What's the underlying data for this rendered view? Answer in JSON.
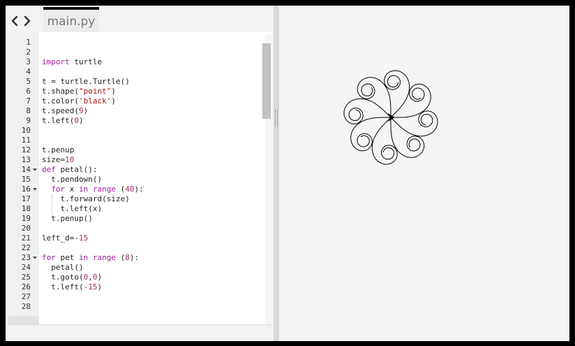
{
  "tab": {
    "label": "main.py"
  },
  "icons": {
    "back": "chevron-left-icon",
    "forward": "chevron-right-icon",
    "fold": "fold-arrow-icon"
  },
  "editor": {
    "lines": [
      {
        "num": "1",
        "text": ""
      },
      {
        "num": "2",
        "text": ""
      },
      {
        "num": "3",
        "text": "import turtle"
      },
      {
        "num": "4",
        "text": ""
      },
      {
        "num": "5",
        "text": "t = turtle.Turtle()"
      },
      {
        "num": "6",
        "text": "t.shape(\"point\")"
      },
      {
        "num": "7",
        "text": "t.color('black')"
      },
      {
        "num": "8",
        "text": "t.speed(9)"
      },
      {
        "num": "9",
        "text": "t.left(0)"
      },
      {
        "num": "10",
        "text": ""
      },
      {
        "num": "11",
        "text": ""
      },
      {
        "num": "12",
        "text": "t.penup"
      },
      {
        "num": "13",
        "text": "size=10"
      },
      {
        "num": "14",
        "text": "def petal():"
      },
      {
        "num": "15",
        "text": "  t.pendown()"
      },
      {
        "num": "16",
        "text": "  for x in range (40):"
      },
      {
        "num": "17",
        "text": "    t.forward(size)"
      },
      {
        "num": "18",
        "text": "    t.left(x)"
      },
      {
        "num": "19",
        "text": "  t.penup()"
      },
      {
        "num": "20",
        "text": ""
      },
      {
        "num": "21",
        "text": "left_d=-15"
      },
      {
        "num": "22",
        "text": ""
      },
      {
        "num": "23",
        "text": "for pet in range (8):"
      },
      {
        "num": "24",
        "text": "  petal()"
      },
      {
        "num": "25",
        "text": "  t.goto(0,0)"
      },
      {
        "num": "26",
        "text": "  t.left(-15)"
      },
      {
        "num": "27",
        "text": ""
      },
      {
        "num": "28",
        "text": ""
      }
    ],
    "foldable_lines": [
      "14",
      "16",
      "23"
    ]
  },
  "colors": {
    "keyword": "#a020a0",
    "number": "#a0306a",
    "string": "#a31515",
    "ink": "#000000"
  }
}
